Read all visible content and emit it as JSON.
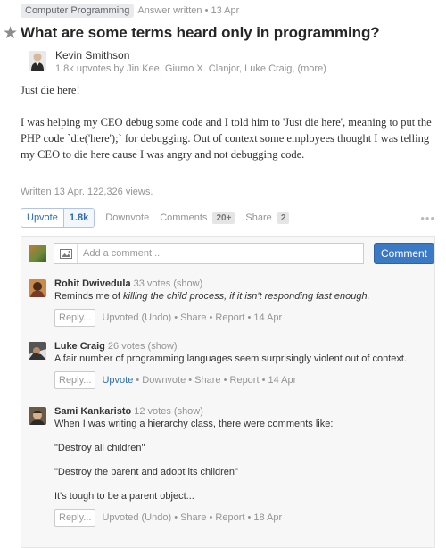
{
  "topline": {
    "tag": "Computer Programming",
    "meta": "Answer written • 13 Apr"
  },
  "question": {
    "title": "What are some terms heard only in programming?"
  },
  "author": {
    "name": "Kevin Smithson",
    "upvoters": "1.8k upvotes by Jin Kee, Giumo X. Clanjor, Luke Craig, (more)"
  },
  "answer": {
    "paragraphs": [
      "Just die here!",
      "I was helping my CEO debug some code and I told him to 'Just die here', meaning to put the PHP code `die('here');` for debugging.  Out of context some employees thought I was telling my CEO to die here cause I was angry and not debugging code."
    ],
    "written": "Written 13 Apr. 122,326 views."
  },
  "actions": {
    "upvote_label": "Upvote",
    "upvote_count": "1.8k",
    "downvote_label": "Downvote",
    "comments_label": "Comments",
    "comments_count": "20+",
    "share_label": "Share",
    "share_count": "2",
    "more": "•••"
  },
  "composer": {
    "placeholder": "Add a comment...",
    "button": "Comment"
  },
  "comments": [
    {
      "name": "Rohit Dwivedula",
      "votes": "33 votes (show)",
      "text_plain": "Reminds me of ",
      "text_em": "killing the child process, if it isn't responding fast enough.",
      "reply": "Reply...",
      "actions": "Upvoted (Undo) • Share • Report • 14 Apr"
    },
    {
      "name": "Luke Craig",
      "votes": "26 votes (show)",
      "text": "A fair number of programming languages seem surprisingly violent out of context.",
      "reply": "Reply...",
      "upvote": "Upvote",
      "actions": " • Downvote • Share • Report • 14 Apr"
    },
    {
      "name": "Sami Kankaristo",
      "votes": "12 votes (show)",
      "paragraphs": [
        "When I was writing a hierarchy class, there were comments like:",
        "\"Destroy all children\"",
        "\"Destroy the parent and adopt its children\"",
        "It's tough to be a parent object..."
      ],
      "reply": "Reply...",
      "actions": "Upvoted (Undo) • Share • Report • 18 Apr"
    }
  ],
  "colors": {
    "accent": "#3b79c4",
    "link": "#2b6dad",
    "muted": "#949494"
  }
}
